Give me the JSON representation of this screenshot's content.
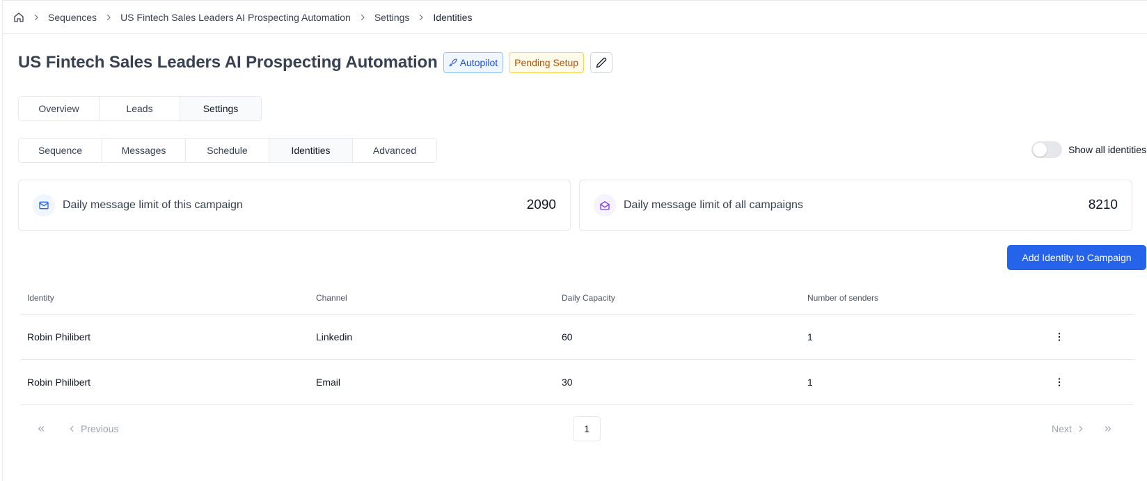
{
  "breadcrumb": {
    "home_icon": "home-icon",
    "items": [
      "Sequences",
      "US Fintech Sales Leaders AI Prospecting Automation",
      "Settings",
      "Identities"
    ]
  },
  "header": {
    "title": "US Fintech Sales Leaders AI Prospecting Automation",
    "autopilot_badge": "Autopilot",
    "status_badge": "Pending Setup",
    "edit_icon": "pencil-icon"
  },
  "main_tabs": [
    {
      "label": "Overview",
      "active": false
    },
    {
      "label": "Leads",
      "active": false
    },
    {
      "label": "Settings",
      "active": true
    }
  ],
  "settings_tabs": [
    {
      "label": "Sequence",
      "active": false
    },
    {
      "label": "Messages",
      "active": false
    },
    {
      "label": "Schedule",
      "active": false
    },
    {
      "label": "Identities",
      "active": true
    },
    {
      "label": "Advanced",
      "active": false
    }
  ],
  "toggle": {
    "label": "Show all identities",
    "on": false
  },
  "stats": {
    "campaign": {
      "icon": "mail-icon",
      "label": "Daily message limit of this campaign",
      "value": "2090"
    },
    "all": {
      "icon": "mail-open-icon",
      "label": "Daily message limit of all campaigns",
      "value": "8210"
    }
  },
  "add_button": "Add Identity to Campaign",
  "table": {
    "columns": [
      "Identity",
      "Channel",
      "Daily Capacity",
      "Number of senders"
    ],
    "rows": [
      [
        "Robin Philibert",
        "Linkedin",
        "60",
        "1"
      ],
      [
        "Robin Philibert",
        "Email",
        "30",
        "1"
      ]
    ]
  },
  "pagination": {
    "previous": "Previous",
    "next": "Next",
    "current_page": "1"
  },
  "colors": {
    "primary": "#2563eb",
    "autopilot": "#1d4ed8",
    "pending": "#b45309"
  }
}
